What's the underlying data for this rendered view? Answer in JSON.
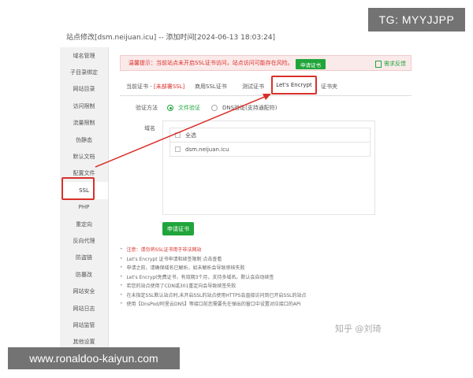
{
  "watermarks": {
    "tg": "TG: MYYJJPP",
    "url": "www.ronaldoo-kaiyun.com",
    "zhihu": "知乎 @刘琦"
  },
  "dialog": {
    "title": "站点修改[dsm.neijuan.icu] -- 添加时间[2024-06-13 18:03:24]"
  },
  "sidebar": {
    "items": [
      {
        "label": "域名管理"
      },
      {
        "label": "子目录绑定"
      },
      {
        "label": "网站目录"
      },
      {
        "label": "访问限制"
      },
      {
        "label": "流量限制"
      },
      {
        "label": "伪静态"
      },
      {
        "label": "默认文档"
      },
      {
        "label": "配置文件"
      },
      {
        "label": "SSL"
      },
      {
        "label": "PHP"
      },
      {
        "label": "重定向"
      },
      {
        "label": "反向代理"
      },
      {
        "label": "防盗链"
      },
      {
        "label": "防篡改"
      },
      {
        "label": "网站安全"
      },
      {
        "label": "网站日志"
      },
      {
        "label": "网站监管"
      },
      {
        "label": "其他设置"
      }
    ]
  },
  "warning": {
    "text": "温馨提示：当前站点未开启SSL证书访问，站点访问可能存在风险。",
    "button": "申请证书",
    "feedback": "需求反馈"
  },
  "tabs": {
    "current_prefix": "当前证书 - ",
    "current_status": "[未部署SSL]",
    "items": [
      "商用SSL证书",
      "测试证书",
      "Let's Encrypt",
      "证书夹"
    ]
  },
  "verify": {
    "label": "验证方法",
    "option_file": "文件验证",
    "option_dns": "DNS验证(支持通配符)"
  },
  "domain": {
    "label": "域名",
    "rows": [
      {
        "text": "全选"
      },
      {
        "text": "dsm.neijuan.icu"
      }
    ]
  },
  "apply_button": "申请证书",
  "notes": [
    {
      "text": "注意：请勿将SSL证书用于非法网站",
      "red": true
    },
    {
      "text": "Let's Encrypt 证书申请和续签限制 点击查看",
      "red": false
    },
    {
      "text": "申请之前，请确保域名已解析，如未解析会导致审核失败",
      "red": false
    },
    {
      "text": "Let's Encrypt免费证书，有效期3个月，支持多域名。默认会自动续签",
      "red": false
    },
    {
      "text": "若您的站点使用了CDN或301重定向会导致续签失败",
      "red": false
    },
    {
      "text": "在未指定SSL默认站点时,未开启SSL的站点使用HTTPS会直接访问到已开启SSL的站点",
      "red": false
    },
    {
      "text": "使用【DnsPod/阿里云DNS】等接口前您需要先在弹出的窗口中设置对应接口的API",
      "red": false
    }
  ],
  "colors": {
    "accent_green": "#20a53a",
    "highlight_red": "#d9302a"
  }
}
